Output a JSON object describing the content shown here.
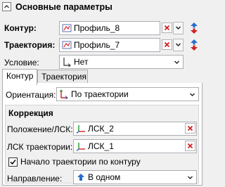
{
  "header": {
    "title": "Основные параметры"
  },
  "contour": {
    "label": "Контур:",
    "value": "Профиль_8"
  },
  "trajectory": {
    "label": "Траектория:",
    "value": "Профиль_7"
  },
  "condition": {
    "label": "Условие:",
    "value": "Нет"
  },
  "tabs": [
    {
      "label": "Контур"
    },
    {
      "label": "Траектория"
    }
  ],
  "orientation": {
    "label": "Ориентация:",
    "value": "По траектории"
  },
  "correction": {
    "title": "Коррекция",
    "position": {
      "label": "Положение/ЛСК:",
      "value": "ЛСК_2"
    },
    "trajectory_lsk": {
      "label": "ЛСК траектории:",
      "value": "ЛСК_1"
    },
    "start_checkbox": {
      "label": "Начало траектории по контуру",
      "checked": true
    },
    "direction": {
      "label": "Направление:",
      "value": "В одном"
    }
  },
  "colors": {
    "accent_red": "#d32020",
    "lsk_blue": "#2060d0",
    "lsk_green": "#1f9a2e"
  }
}
